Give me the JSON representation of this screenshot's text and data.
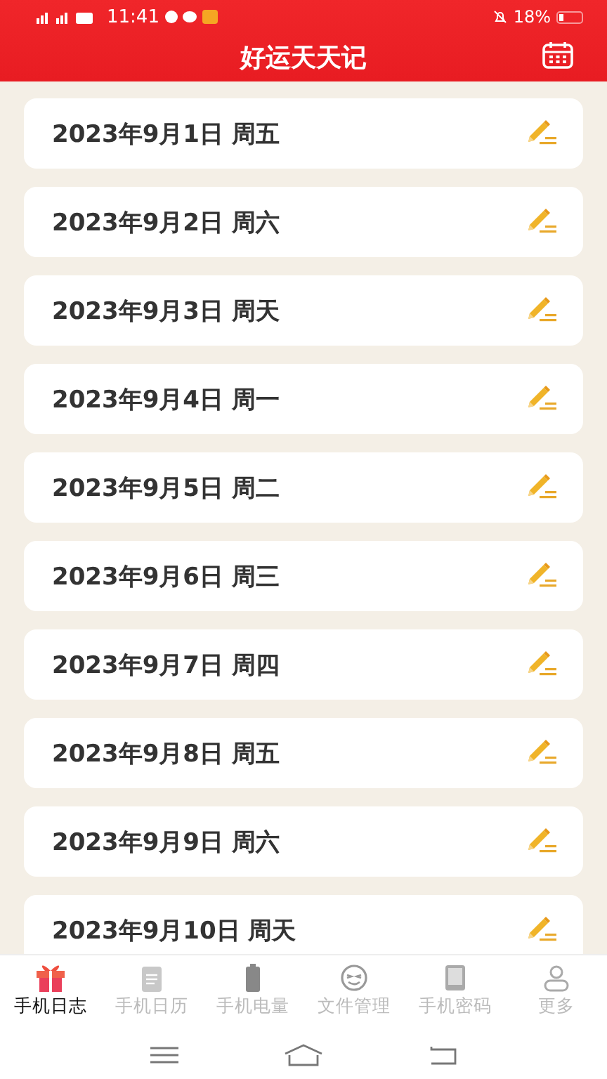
{
  "status_bar": {
    "time": "11:41",
    "battery": "18%"
  },
  "header": {
    "title": "好运天天记"
  },
  "entries": [
    {
      "date": "2023年9月1日 周五"
    },
    {
      "date": "2023年9月2日 周六"
    },
    {
      "date": "2023年9月3日 周天"
    },
    {
      "date": "2023年9月4日 周一"
    },
    {
      "date": "2023年9月5日 周二"
    },
    {
      "date": "2023年9月6日 周三"
    },
    {
      "date": "2023年9月7日 周四"
    },
    {
      "date": "2023年9月8日 周五"
    },
    {
      "date": "2023年9月9日 周六"
    },
    {
      "date": "2023年9月10日 周天"
    }
  ],
  "tabs": [
    {
      "label": "手机日志",
      "kind": "gift",
      "selected": true
    },
    {
      "label": "手机日历",
      "kind": "note",
      "selected": false
    },
    {
      "label": "手机电量",
      "kind": "battery",
      "selected": false
    },
    {
      "label": "文件管理",
      "kind": "face",
      "selected": false
    },
    {
      "label": "手机密码",
      "kind": "tablet",
      "selected": false
    },
    {
      "label": "更多",
      "kind": "person",
      "selected": false
    }
  ]
}
